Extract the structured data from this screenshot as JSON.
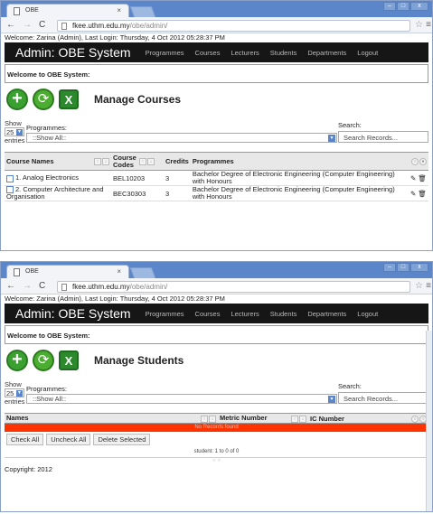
{
  "browser": {
    "tab_title": "OBE",
    "tab_close": "×",
    "url_host": "fkee.uthm.edu.my",
    "url_path": "/obe/admin/",
    "win_minimize": "–",
    "win_maximize": "□",
    "win_close": "x",
    "back": "←",
    "forward": "→",
    "reload": "C",
    "star": "☆",
    "menu": "≡"
  },
  "welcome_line": "Welcome: Zarina (Admin), Last Login: Thursday, 4 Oct 2012 05:28:37 PM",
  "header": {
    "title": "Admin: OBE System",
    "nav": [
      "Programmes",
      "Courses",
      "Lecturers",
      "Students",
      "Departments",
      "Logout"
    ]
  },
  "welcome_box": "Welcome to OBE System:",
  "icons": {
    "add": "+",
    "refresh": "⟳",
    "excel": "X"
  },
  "filters": {
    "show": "Show",
    "entries": "entries",
    "length": "25",
    "programmes_label": "Programmes:",
    "programmes_value": "::Show All::",
    "search_label": "Search:",
    "search_placeholder": "Search Records..."
  },
  "courses": {
    "title": "Manage Courses",
    "columns": {
      "name": "Course Names",
      "code": "Course Codes",
      "credits": "Credits",
      "programmes": "Programmes"
    },
    "rows": [
      {
        "name": "1. Analog Electronics",
        "code": "BEL10203",
        "credits": "3",
        "programme": "Bachelor Degree of Electronic Engineering (Computer Engineering) with Honours"
      },
      {
        "name": "2. Computer Architecture and Organisation",
        "code": "BEC30303",
        "credits": "3",
        "programme": "Bachelor Degree of Electronic Engineering (Computer Engineering) with Honours"
      }
    ]
  },
  "students": {
    "title": "Manage Students",
    "columns": {
      "names": "Names",
      "metric": "Metric Number",
      "ic": "IC Number"
    },
    "no_records": "No Records found",
    "buttons": [
      "Check All",
      "Uncheck All",
      "Delete Selected"
    ],
    "info": "student: 1 to 0 of 0"
  },
  "footer": "Copyright: 2012"
}
